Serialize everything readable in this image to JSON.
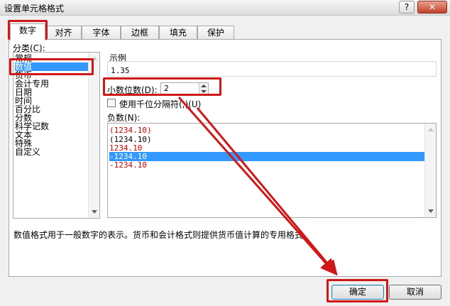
{
  "window": {
    "title": "设置单元格格式",
    "help_label": "?",
    "close_label": "✕"
  },
  "tabs": [
    {
      "label": "数字",
      "active": true
    },
    {
      "label": "对齐"
    },
    {
      "label": "字体"
    },
    {
      "label": "边框"
    },
    {
      "label": "填充"
    },
    {
      "label": "保护"
    }
  ],
  "category": {
    "label": "分类(C):",
    "items": [
      "常规",
      "数值",
      "货币",
      "会计专用",
      "日期",
      "时间",
      "百分比",
      "分数",
      "科学记数",
      "文本",
      "特殊",
      "自定义"
    ],
    "selected": "数值"
  },
  "sample": {
    "label": "示例",
    "value": "1.35"
  },
  "decimal": {
    "label": "小数位数(D):",
    "value": "2"
  },
  "separator": {
    "label": "使用千位分隔符(,)(U)",
    "checked": false
  },
  "negative": {
    "label": "负数(N):",
    "items": [
      {
        "text": "(1234.10)",
        "color": "#cc0000"
      },
      {
        "text": "(1234.10)",
        "color": "#000000"
      },
      {
        "text": "1234.10",
        "color": "#cc0000"
      },
      {
        "text": "-1234.10",
        "color": "#ffffff",
        "selected": true
      },
      {
        "text": "-1234.10",
        "color": "#cc0000"
      }
    ]
  },
  "description": "数值格式用于一般数字的表示。货币和会计格式则提供货币值计算的专用格式。",
  "buttons": {
    "ok": "确定",
    "cancel": "取消"
  },
  "annotation_color": "#d01818"
}
